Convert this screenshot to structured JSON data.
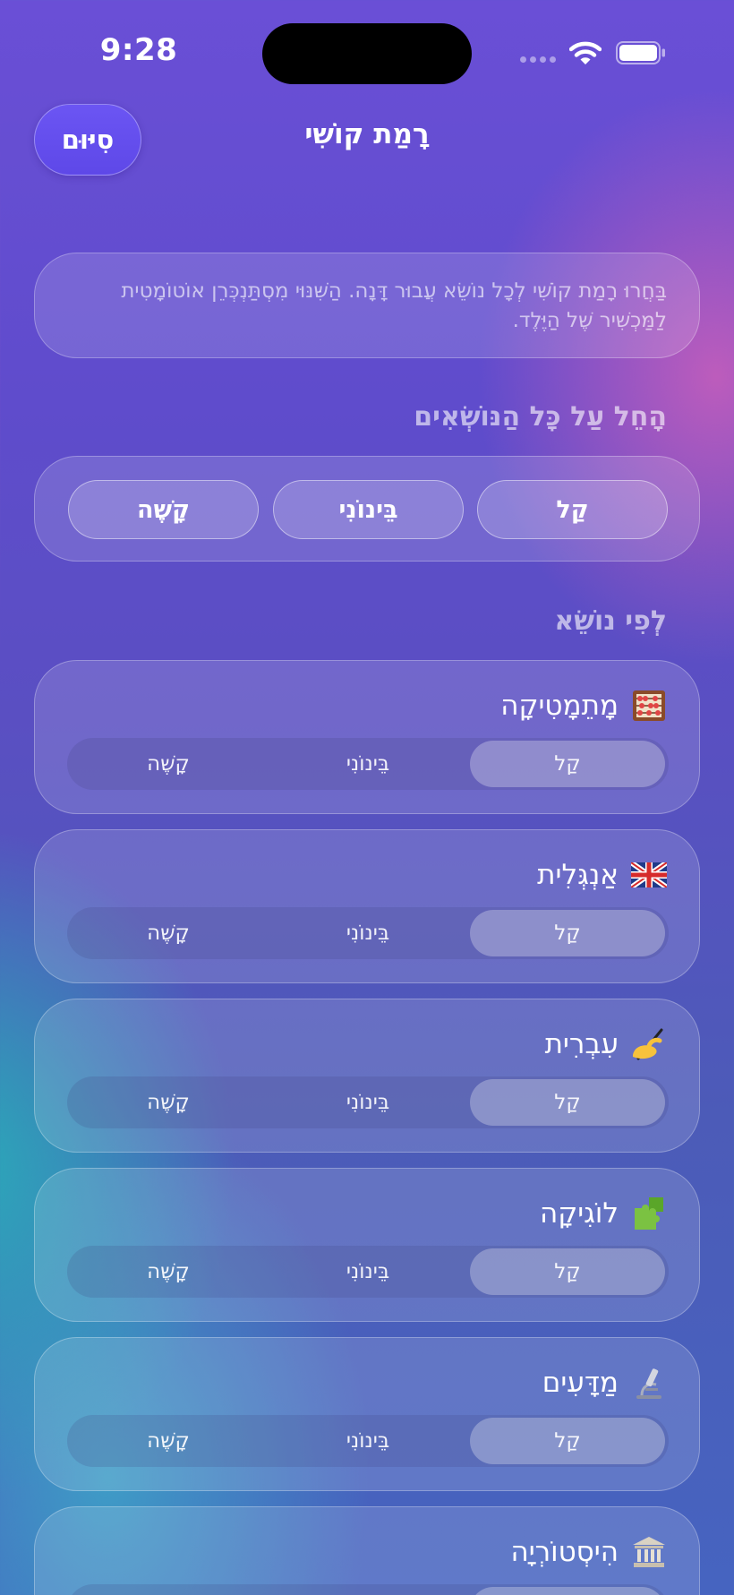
{
  "status_bar": {
    "time": "9:28"
  },
  "nav": {
    "done_label": "סִיּוּם",
    "title": "רָמַת קוֹשִׁי"
  },
  "info": {
    "text": "בַּחֲרוּ רָמַת קוֹשִׁי לְכָל נוֹשֵׂא עֲבוּר דָּנָה. הַשִּׁנּוּי מִסְתַּנְכְּרֵן אוֹטוֹמָטִית לַמַּכְשִׁיר שֶׁל הַיֶּלֶד."
  },
  "apply_all": {
    "label": "הָחֵל עַל כָּל הַנּוֹשְׂאִים",
    "easy": "קַל",
    "medium": "בֵּינוֹנִי",
    "hard": "קָשֶׁה"
  },
  "per_subject_label": "לְפִי נוֹשֵׂא",
  "levels": {
    "easy": "קַל",
    "medium": "בֵּינוֹנִי",
    "hard": "קָשֶׁה"
  },
  "subjects": [
    {
      "name": "מָתֵמָטִיקָה",
      "icon": "abacus-icon",
      "selected": "easy"
    },
    {
      "name": "אַנְגְּלִית",
      "icon": "uk-flag-icon",
      "selected": "easy"
    },
    {
      "name": "עִבְרִית",
      "icon": "writing-hand-icon",
      "selected": "easy"
    },
    {
      "name": "לוֹגִיקָה",
      "icon": "puzzle-icon",
      "selected": "easy"
    },
    {
      "name": "מַדָּעִים",
      "icon": "microscope-icon",
      "selected": "easy"
    },
    {
      "name": "הִיסְטוֹרְיָה",
      "icon": "museum-icon",
      "selected": "easy"
    }
  ]
}
